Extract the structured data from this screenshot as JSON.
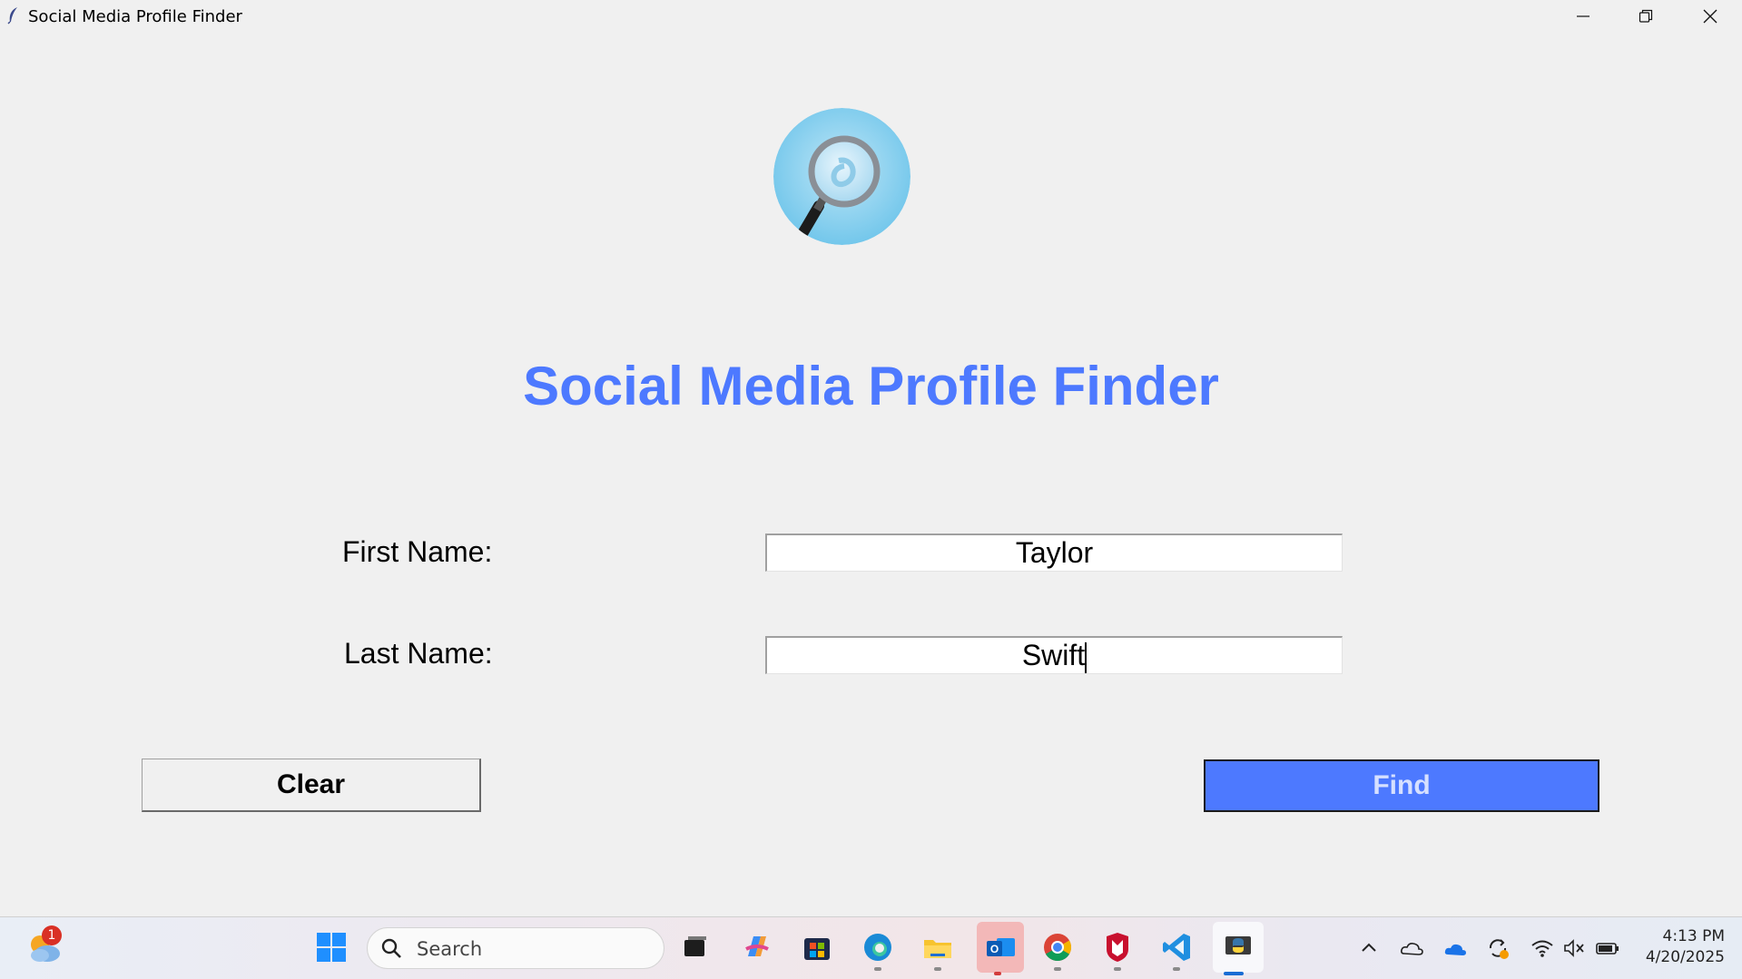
{
  "window": {
    "title": "Social Media Profile Finder",
    "controls": [
      "minimize",
      "restore",
      "close"
    ]
  },
  "app": {
    "logo_icon": "magnifier-icon",
    "heading": "Social Media Profile Finder",
    "heading_color": "#4d79ff",
    "form": {
      "first_name_label": "First Name:",
      "first_name_value": "Taylor",
      "last_name_label": "Last Name:",
      "last_name_value": "Swift"
    },
    "buttons": {
      "clear_label": "Clear",
      "find_label": "Find",
      "find_color": "#4d79ff"
    }
  },
  "taskbar": {
    "weather_badge": "1",
    "search_placeholder": "Search",
    "apps": [
      "start-icon",
      "task-view-icon",
      "copilot-icon",
      "store-icon",
      "edge-icon",
      "file-explorer-icon",
      "outlook-icon",
      "chrome-icon",
      "mcafee-icon",
      "vscode-icon",
      "python-icon"
    ],
    "tray": [
      "chevron-up-icon",
      "onedrive-cloud-icon",
      "onedrive-blue-icon",
      "sync-icon",
      "wifi-icon",
      "mute-icon",
      "battery-icon"
    ],
    "clock_time": "4:13 PM",
    "clock_date": "4/20/2025"
  }
}
